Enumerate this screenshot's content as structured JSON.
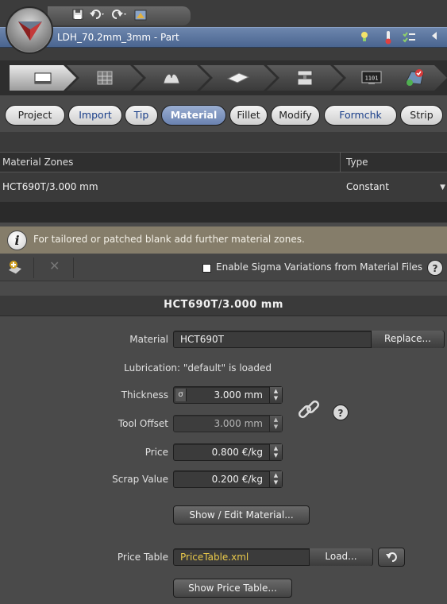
{
  "window": {
    "document_title": "LDH_70.2mm_3mm - Part"
  },
  "quick_access": {
    "icons": [
      "save-icon",
      "undo-icon",
      "redo-icon",
      "customize-icon"
    ]
  },
  "doc_icons": [
    "lightbulb-icon",
    "thermometer-icon",
    "checklist-icon",
    "collapse-icon"
  ],
  "process_steps": [
    {
      "icon": "sheet-icon",
      "active": true
    },
    {
      "icon": "grid-icon",
      "active": false
    },
    {
      "icon": "draw-icon",
      "active": false
    },
    {
      "icon": "blank-icon",
      "active": false
    },
    {
      "icon": "press-icon",
      "active": false
    },
    {
      "icon": "counter-icon",
      "text": "1101",
      "active": false
    },
    {
      "icon": "result-icon",
      "active": false
    }
  ],
  "tabs": [
    {
      "label": "Project",
      "style": "normal"
    },
    {
      "label": "Import",
      "style": "blue"
    },
    {
      "label": "Tip",
      "style": "blue"
    },
    {
      "label": "Material",
      "style": "active"
    },
    {
      "label": "Fillet",
      "style": "normal"
    },
    {
      "label": "Modify",
      "style": "normal"
    },
    {
      "label": "Formchk",
      "style": "blue"
    },
    {
      "label": "Strip",
      "style": "normal"
    }
  ],
  "material_zones": {
    "columns": [
      "Material Zones",
      "Type"
    ],
    "rows": [
      {
        "zone": "HCT690T/3.000 mm",
        "type": "Constant"
      }
    ]
  },
  "info": {
    "text": "For tailored or patched blank add further material zones."
  },
  "zone_toolbar": {
    "sigma_label": "Enable Sigma Variations from Material Files",
    "sigma_checked": false,
    "help": "?"
  },
  "section": {
    "title": "HCT690T/3.000 mm"
  },
  "form": {
    "material_label": "Material",
    "material_value": "HCT690T",
    "replace_label": "Replace...",
    "lubrication_text": "Lubrication: \"default\" is loaded",
    "thickness_label": "Thickness",
    "thickness_sigma": "σ",
    "thickness_value": "3.000 mm",
    "tool_offset_label": "Tool Offset",
    "tool_offset_value": "3.000 mm",
    "price_label": "Price",
    "price_value": "0.800 €/kg",
    "scrap_label": "Scrap Value",
    "scrap_value": "0.200 €/kg",
    "help": "?",
    "show_edit_label": "Show / Edit Material...",
    "price_table_label": "Price Table",
    "price_table_value": "PriceTable.xml",
    "load_label": "Load...",
    "show_price_table_label": "Show Price Table..."
  },
  "colors": {
    "accent_blue": "#5a72a0",
    "info_bar": "#857d6a",
    "price_table_text": "#e8c84a"
  }
}
